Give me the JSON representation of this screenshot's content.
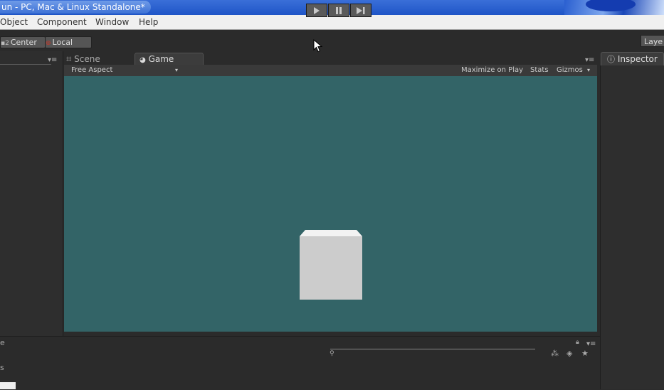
{
  "window": {
    "title": "un - PC, Mac & Linux Standalone*"
  },
  "menu": {
    "items": [
      "Object",
      "Component",
      "Window",
      "Help"
    ]
  },
  "toolbar": {
    "center_label": "Center",
    "local_label": "Local",
    "play_icon": "play-icon",
    "pause_icon": "pause-icon",
    "step_icon": "step-icon",
    "layers_label": "Laye"
  },
  "scene_view": {
    "tabs": [
      {
        "label": "Scene",
        "icon": "grid-icon",
        "active": false
      },
      {
        "label": "Game",
        "icon": "game-controller-icon",
        "active": true
      }
    ],
    "aspect": "Free Aspect",
    "maximize_on_play": "Maximize on Play",
    "stats": "Stats",
    "gizmos": "Gizmos",
    "background_color": "#336467",
    "cube_front_color": "#cccccc",
    "cube_top_color": "#f2f2f2"
  },
  "inspector": {
    "tab_label": "Inspector",
    "icon": "info-icon"
  },
  "bottom": {
    "left_label": "e",
    "left_label2": "s",
    "search_icon": "search-icon",
    "icons": [
      "person-group-icon",
      "tag-icon",
      "star-icon"
    ]
  },
  "colors": {
    "editor_bg": "#2b2b2b",
    "titlebar": "#1f55c7"
  }
}
